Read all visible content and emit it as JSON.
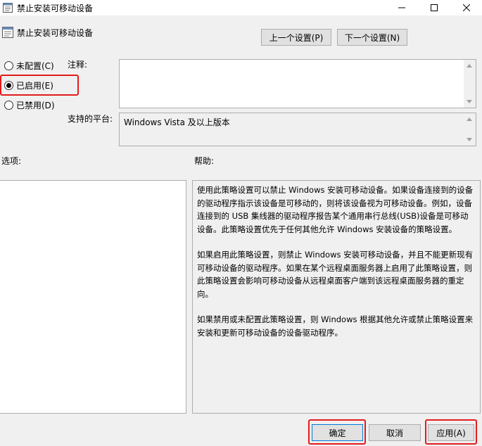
{
  "window": {
    "title": "禁止安装可移动设备"
  },
  "header": {
    "policy_name": "禁止安装可移动设备",
    "prev_button": "上一个设置(P)",
    "next_button": "下一个设置(N)"
  },
  "state": {
    "options": [
      {
        "label": "未配置(C)",
        "selected": false
      },
      {
        "label": "已启用(E)",
        "selected": true
      },
      {
        "label": "已禁用(D)",
        "selected": false
      }
    ]
  },
  "comment": {
    "label": "注释:",
    "value": ""
  },
  "platform": {
    "label": "支持的平台:",
    "value": "Windows Vista 及以上版本"
  },
  "sections": {
    "options_label": "选项:",
    "help_label": "帮助:"
  },
  "help": {
    "paragraphs": [
      "使用此策略设置可以禁止 Windows 安装可移动设备。如果设备连接到的设备的驱动程序指示该设备是可移动的，则将该设备视为可移动设备。例如，设备连接到的 USB 集线器的驱动程序报告某个通用串行总线(USB)设备是可移动设备。此策略设置优先于任何其他允许 Windows 安装设备的策略设置。",
      "如果启用此策略设置，则禁止 Windows 安装可移动设备，并且不能更新现有可移动设备的驱动程序。如果在某个远程桌面服务器上启用了此策略设置，则此策略设置会影响可移动设备从远程桌面客户端到该远程桌面服务器的重定向。",
      "如果禁用或未配置此策略设置，则 Windows 根据其他允许或禁止策略设置来安装和更新可移动设备的设备驱动程序。"
    ]
  },
  "footer": {
    "ok": "确定",
    "cancel": "取消",
    "apply": "应用(A)"
  },
  "colors": {
    "highlight": "#e31b1b",
    "ok_border": "#0078d7"
  }
}
